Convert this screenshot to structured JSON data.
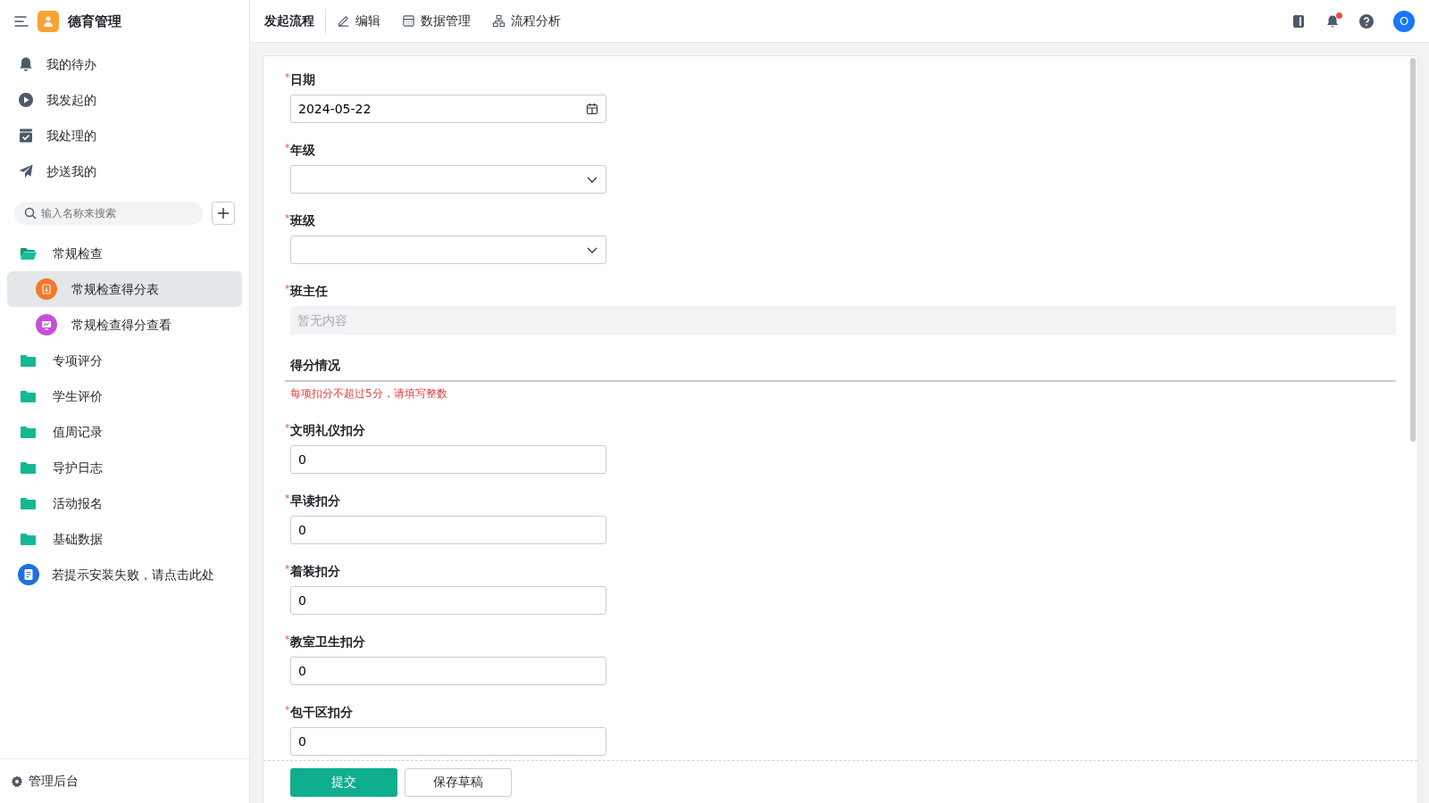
{
  "sidebar": {
    "brand": "德育管理",
    "nav": [
      {
        "kind": "bell",
        "label": "我的待办"
      },
      {
        "kind": "play",
        "label": "我发起的"
      },
      {
        "kind": "check",
        "label": "我处理的"
      },
      {
        "kind": "send",
        "label": "抄送我的"
      }
    ],
    "search": {
      "placeholder": "输入名称来搜索"
    },
    "tree": [
      {
        "label": "常规检查",
        "expanded": true,
        "children": [
          {
            "label": "常规检查得分表",
            "selected": true,
            "color": "#f5772b",
            "kind": "form"
          },
          {
            "label": "常规检查得分查看",
            "selected": false,
            "color": "#c54fd8",
            "kind": "chart"
          }
        ]
      },
      {
        "label": "专项评分",
        "expanded": false
      },
      {
        "label": "学生评价",
        "expanded": false
      },
      {
        "label": "值周记录",
        "expanded": false
      },
      {
        "label": "导护日志",
        "expanded": false
      },
      {
        "label": "活动报名",
        "expanded": false
      },
      {
        "label": "基础数据",
        "expanded": false
      }
    ],
    "help_link": "若提示安装失败，请点击此处",
    "admin": "管理后台"
  },
  "topbar": {
    "tabs": [
      {
        "label": "发起流程",
        "kind": "none",
        "selected": true
      },
      {
        "label": "编辑",
        "kind": "pen",
        "selected": false
      },
      {
        "label": "数据管理",
        "kind": "table",
        "selected": false
      },
      {
        "label": "流程分析",
        "kind": "flow",
        "selected": false
      }
    ],
    "notification_dot": true,
    "avatar": "O"
  },
  "form": {
    "fields": [
      {
        "kind": "date",
        "label": "日期",
        "required_mark": "*",
        "value": "2024-05-22"
      },
      {
        "kind": "select",
        "label": "年级",
        "required_mark": "*"
      },
      {
        "kind": "select",
        "label": "班级",
        "required_mark": "*"
      },
      {
        "kind": "readonly",
        "label": "班主任",
        "required_mark": "*",
        "placeholder": "暂无内容"
      },
      {
        "kind": "section",
        "label": "得分情况",
        "note": "每项扣分不超过5分，请填写整数"
      },
      {
        "kind": "number",
        "label": "文明礼仪扣分",
        "required_mark": "*",
        "value": "0"
      },
      {
        "kind": "number",
        "label": "早读扣分",
        "required_mark": "*",
        "value": "0"
      },
      {
        "kind": "number",
        "label": "着装扣分",
        "required_mark": "*",
        "value": "0"
      },
      {
        "kind": "number",
        "label": "教室卫生扣分",
        "required_mark": "*",
        "value": "0"
      },
      {
        "kind": "number",
        "label": "包干区扣分",
        "required_mark": "*",
        "value": "0"
      }
    ],
    "buttons": [
      {
        "kind": "primary",
        "label": "提交"
      },
      {
        "kind": "secondary",
        "label": "保存草稿"
      }
    ]
  }
}
